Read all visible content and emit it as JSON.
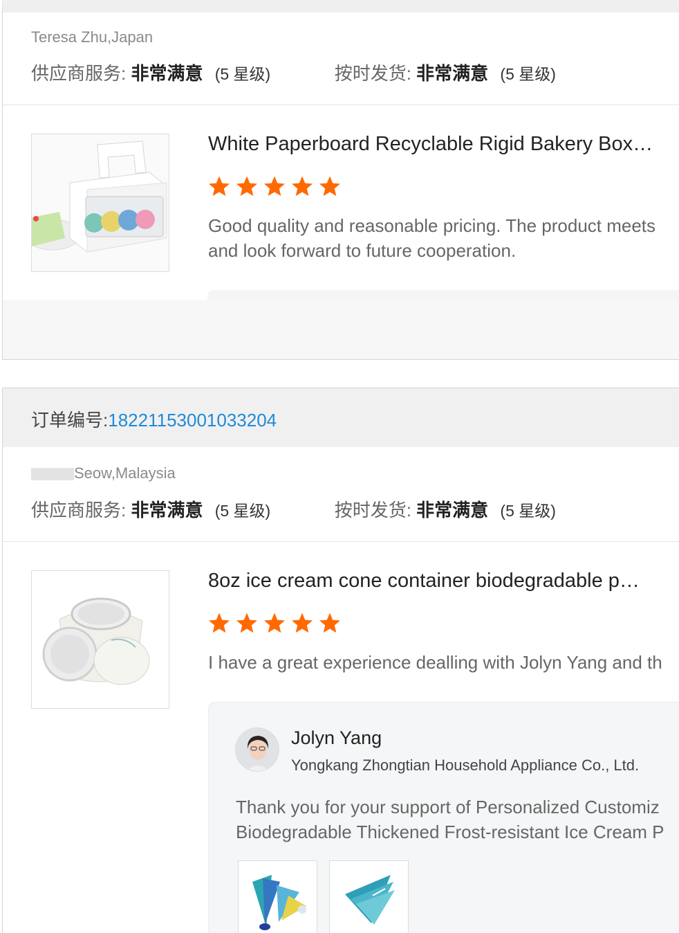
{
  "reviews": [
    {
      "buyer": "Teresa Zhu,Japan",
      "supplier_service": {
        "label": "供应商服务:",
        "value": "非常满意",
        "level": "(5 星级)"
      },
      "on_time": {
        "label": "按时发货:",
        "value": "非常满意",
        "level": "(5 星级)"
      },
      "product": {
        "title": "White Paperboard Recyclable Rigid Bakery Box…",
        "stars": 5,
        "review": "Good quality and reasonable pricing. The product meets",
        "review_line2": "and look forward to future cooperation.",
        "image_icon": "bakery-box-image"
      }
    },
    {
      "order_label": "订单编号:",
      "order_number": "18221153001033204",
      "buyer": "Seow,Malaysia",
      "supplier_service": {
        "label": "供应商服务:",
        "value": "非常满意",
        "level": "(5 星级)"
      },
      "on_time": {
        "label": "按时发货:",
        "value": "非常满意",
        "level": "(5 星级)"
      },
      "product": {
        "title": "8oz ice cream cone container biodegradable p…",
        "stars": 5,
        "review": "I have a great experience dealling with Jolyn Yang and th",
        "image_icon": "paper-cup-image"
      },
      "reply": {
        "seller_name": "Jolyn Yang",
        "company": "Yongkang Zhongtian Household Appliance Co., Ltd.",
        "text_line1": "Thank you for your support of Personalized Customiz",
        "text_line2": "Biodegradable Thickened Frost-resistant Ice Cream P"
      }
    }
  ],
  "colors": {
    "star": "#ff6a00",
    "link": "#1f8ad8"
  }
}
